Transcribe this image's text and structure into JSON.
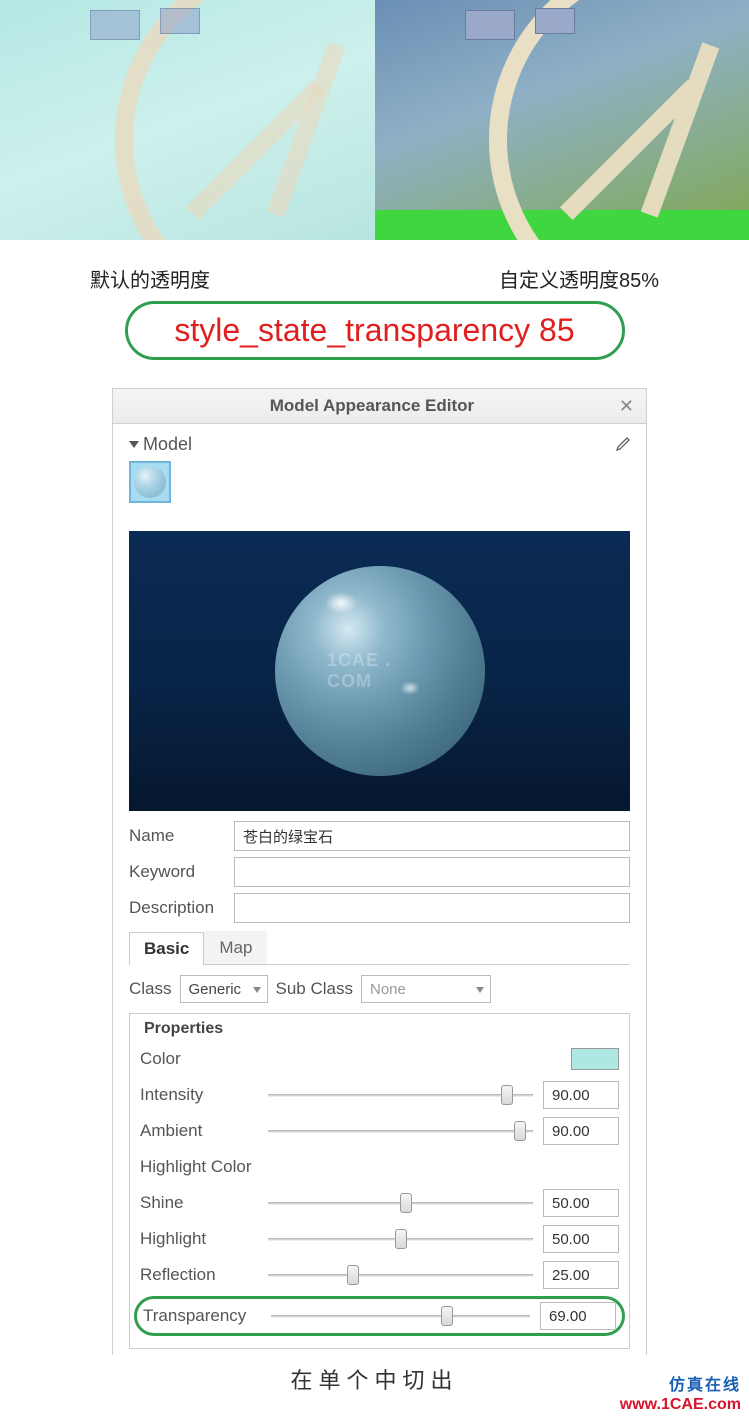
{
  "captions": {
    "left": "默认的透明度",
    "right": "自定义透明度85%"
  },
  "code_badge": "style_state_transparency 85",
  "editor": {
    "title": "Model Appearance Editor",
    "model_label": "Model",
    "watermark": "1CAE . COM",
    "name_label": "Name",
    "name_value": "苍白的绿宝石",
    "keyword_label": "Keyword",
    "keyword_value": "",
    "description_label": "Description",
    "description_value": "",
    "tabs": {
      "basic": "Basic",
      "map": "Map"
    },
    "class_label": "Class",
    "class_value": "Generic",
    "subclass_label": "Sub Class",
    "subclass_value": "None",
    "properties_legend": "Properties",
    "props": {
      "color_label": "Color",
      "intensity": {
        "label": "Intensity",
        "value": "90.00",
        "pct": 90
      },
      "ambient": {
        "label": "Ambient",
        "value": "90.00",
        "pct": 95
      },
      "highlight_color_label": "Highlight Color",
      "shine": {
        "label": "Shine",
        "value": "50.00",
        "pct": 52
      },
      "highlight": {
        "label": "Highlight",
        "value": "50.00",
        "pct": 50
      },
      "reflection": {
        "label": "Reflection",
        "value": "25.00",
        "pct": 32
      },
      "transparency": {
        "label": "Transparency",
        "value": "69.00",
        "pct": 68
      }
    }
  },
  "cutoff": "在单个中切出",
  "footer": {
    "cn": "仿真在线",
    "url": "www.1CAE.com"
  }
}
